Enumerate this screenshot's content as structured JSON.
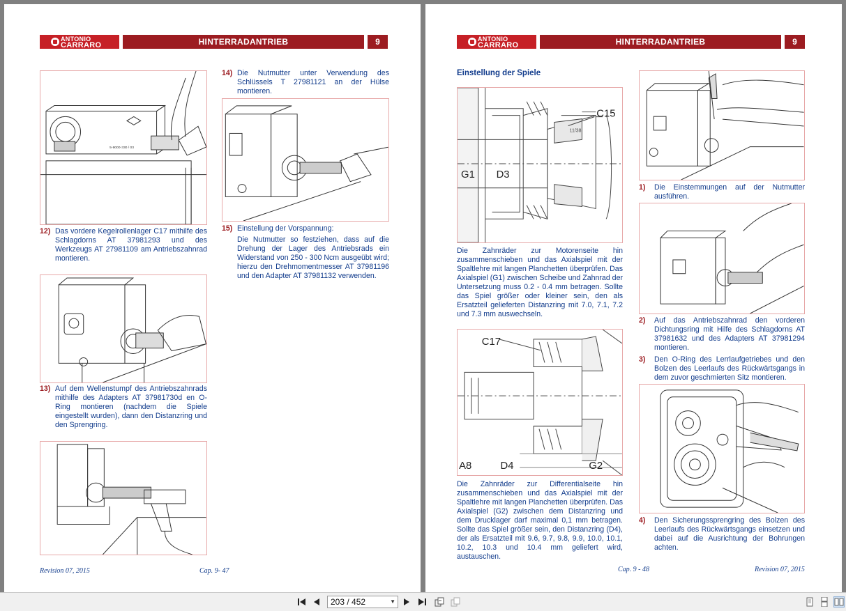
{
  "header": {
    "brand_line1": "ANTONIO",
    "brand_line2": "CARRARO",
    "title": "HINTERRADANTRIEB",
    "chapter_num": "9"
  },
  "left_page": {
    "steps": [
      {
        "num": "12)",
        "text": "Das vordere Kegelrollenlager C17 mithilfe des Schlagdorns AT 37981293 und des Werkzeugs AT 27981109 am Antriebszahnrad montieren."
      },
      {
        "num": "13)",
        "text": "Auf dem Wellenstumpf des Antriebszahnrads mithilfe des Adapters AT 37981730d en O-Ring montieren (nachdem die Spiele eingestellt wurden), dann den Distanzring und den Sprengring."
      },
      {
        "num": "14)",
        "text": "Die Nutmutter unter Verwendung des Schlüssels T 27981121 an der Hülse montieren."
      },
      {
        "num": "15)",
        "text": "Einstellung der Vorspannung:"
      }
    ],
    "step15_body": "Die Nutmutter so festziehen, dass auf die Drehung der Lager des Antriebsrads ein Widerstand von 250 - 300 Ncm ausgeübt wird; hierzu den Drehmomentmesser AT 37981196 und den Adapter AT 37981132 verwenden.",
    "footer_left": "Revision 07, 2015",
    "footer_right": "Cap. 9- 47"
  },
  "right_page": {
    "section_title": "Einstellung der Spiele",
    "para1": "Die Zahnräder zur Motorenseite hin zusammenschieben und das Axialspiel mit der Spaltlehre mit langen Planchetten überprüfen. Das Axialspiel (G1) zwischen Scheibe und Zahnrad der Untersetzung muss 0.2 - 0.4 mm betragen. Sollte das Spiel größer oder kleiner sein, den als Ersatzteil gelieferten Distanzring mit 7.0, 7.1, 7.2 und 7.3 mm auswechseln.",
    "para2": "Die Zahnräder zur Differentialseite hin zusammenschieben und das Axialspiel mit der Spaltlehre mit langen Planchetten überprüfen. Das Axialspiel (G2) zwischen dem Distanzring und dem Drucklager darf maximal 0,1 mm betragen. Sollte das Spiel größer sein, den Distanzring (D4), der als Ersatzteil mit 9.6, 9.7, 9.8, 9.9, 10.0, 10.1, 10.2, 10.3 und 10.4 mm geliefert wird, austauschen.",
    "diagram1_labels": {
      "c15": "C15",
      "g1": "G1",
      "d3": "D3",
      "mark": "11/38"
    },
    "diagram2_labels": {
      "c17": "C17",
      "a8": "A8",
      "d4": "D4",
      "g2": "G2"
    },
    "steps": [
      {
        "num": "1)",
        "text": "Die Einstemmungen auf der Nutmutter ausführen."
      },
      {
        "num": "2)",
        "text": "Auf das Antriebszahnrad den vorderen Dichtungsring mit Hilfe des Schlagdorns AT 37981632 und des Adapters AT 37981294 montieren."
      },
      {
        "num": "3)",
        "text": "Den O-Ring des Lerrlaufgetriebes und den Bolzen des Leerlaufs des Rückwärtsgangs in dem zuvor geschmierten Sitz montieren."
      },
      {
        "num": "4)",
        "text": "Den Sicherungssprengring des Bolzen des Leerlaufs des Rückwärtsgangs einsetzen und dabei auf die Ausrichtung der Bohrungen achten."
      }
    ],
    "footer_left": "Cap. 9 - 48",
    "footer_right": "Revision 07, 2015"
  },
  "toolbar": {
    "page_indicator": "203 / 452"
  },
  "colors": {
    "header_red": "#9c1c21",
    "logo_red": "#c62026",
    "text_blue": "#123c8c",
    "frame_pink": "#e7a8a8"
  }
}
